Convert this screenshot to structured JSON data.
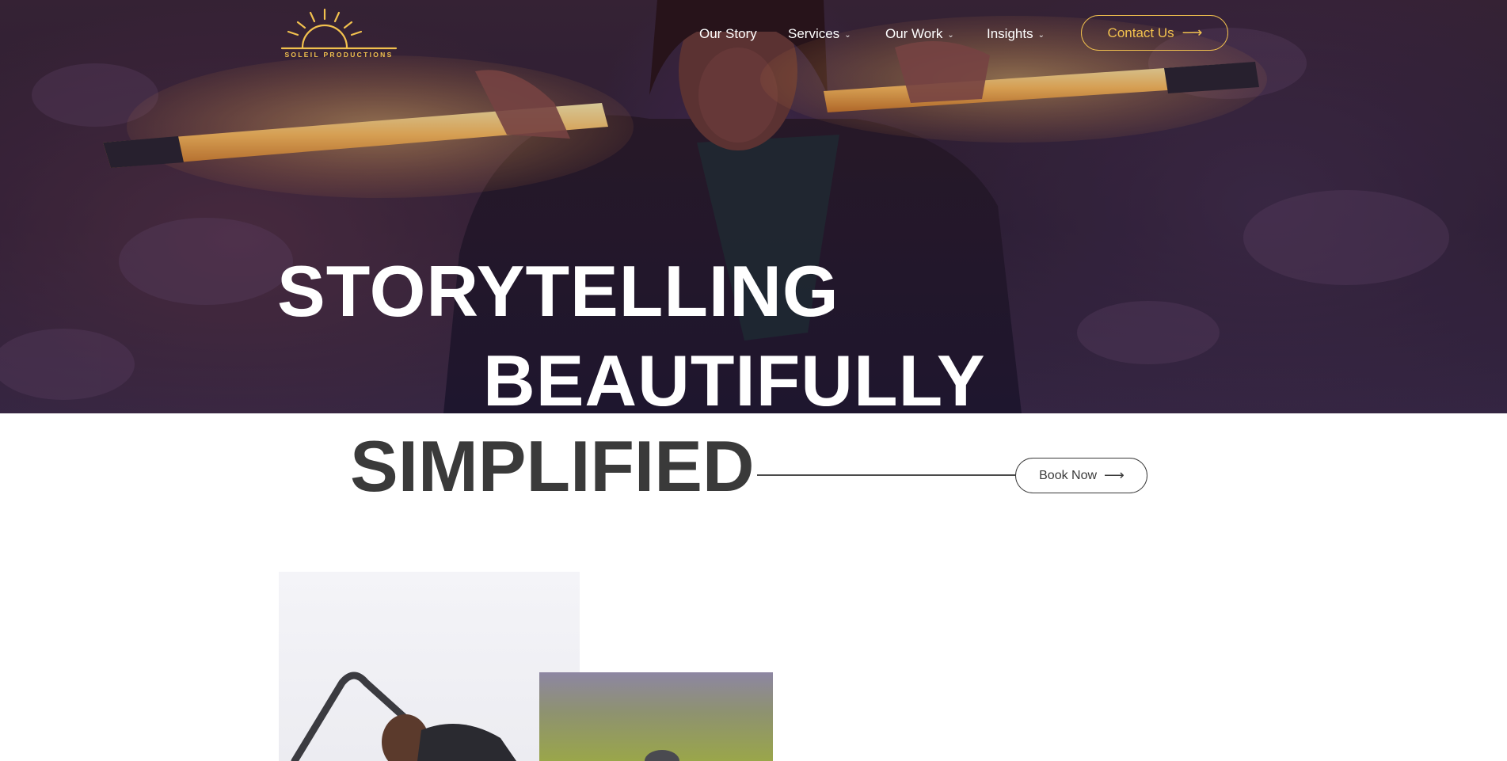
{
  "brand": {
    "name": "SOLEIL PRODUCTIONS",
    "accent_color": "#f2c14e"
  },
  "nav": {
    "items": [
      {
        "label": "Our Story",
        "has_dropdown": false
      },
      {
        "label": "Services",
        "has_dropdown": true
      },
      {
        "label": "Our Work",
        "has_dropdown": true
      },
      {
        "label": "Insights",
        "has_dropdown": true
      }
    ],
    "cta": {
      "label": "Contact Us",
      "arrow": "⟶"
    }
  },
  "hero": {
    "line1": "STORYTELLING",
    "line2": "BEAUTIFULLY",
    "line3": "SIMPLIFIED",
    "book_button": {
      "label": "Book Now",
      "arrow": "⟶"
    }
  },
  "icons": {
    "logo": "sun-logo-icon",
    "dropdown": "chevron-down-icon",
    "arrow": "arrow-right-icon"
  }
}
